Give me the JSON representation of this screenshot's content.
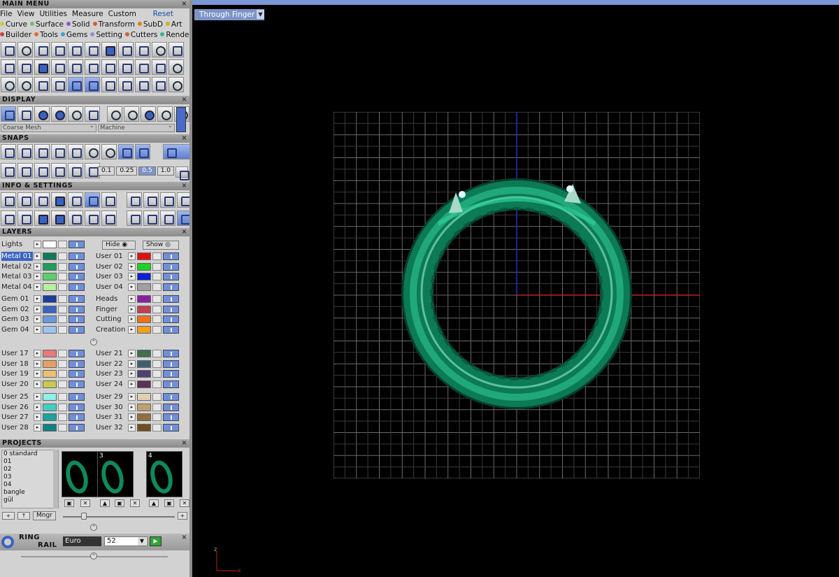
{
  "main_menu": {
    "title": "MAIN MENU",
    "menu": [
      "File",
      "View",
      "Utilities",
      "Measure",
      "Custom"
    ],
    "reset": "Reset",
    "tabs_row1": [
      {
        "label": "Curve",
        "color": "#c8c84a"
      },
      {
        "label": "Surface",
        "color": "#6cc06c"
      },
      {
        "label": "Solid",
        "color": "#8a5ad0"
      },
      {
        "label": "Transform",
        "color": "#d06030"
      },
      {
        "label": "SubD",
        "color": "#e08020"
      },
      {
        "label": "Art",
        "color": "#d0b020"
      }
    ],
    "tabs_row2": [
      {
        "label": "Builder",
        "color": "#d04040"
      },
      {
        "label": "Tools",
        "color": "#e07030"
      },
      {
        "label": "Gems",
        "color": "#40a0d0"
      },
      {
        "label": "Setting",
        "color": "#9090d0"
      },
      {
        "label": "Cutters",
        "color": "#d06040"
      },
      {
        "label": "Render",
        "color": "#40b090"
      }
    ]
  },
  "display": {
    "title": "DISPLAY",
    "mesh_combo": "Coarse Mesh",
    "material_combo": "Machine"
  },
  "snaps": {
    "title": "SNAPS",
    "values": [
      "0.1",
      "0.25",
      "0.5",
      "1.0"
    ]
  },
  "info": {
    "title": "INFO & SETTINGS"
  },
  "layers": {
    "title": "LAYERS",
    "lights": "Lights",
    "hide": "Hide",
    "show": "Show",
    "left_groups": [
      [
        {
          "name": "Metal 01",
          "color": "#0f7a5a"
        },
        {
          "name": "Metal 02",
          "color": "#1f9e5a"
        },
        {
          "name": "Metal 03",
          "color": "#5ccf6c"
        },
        {
          "name": "Metal 04",
          "color": "#b8f0a0"
        }
      ],
      [
        {
          "name": "Gem 01",
          "color": "#1e3c9a"
        },
        {
          "name": "Gem 02",
          "color": "#3a64c0"
        },
        {
          "name": "Gem 03",
          "color": "#6a98e0"
        },
        {
          "name": "Gem 04",
          "color": "#9cc4f0"
        }
      ],
      [
        {
          "name": "User 17",
          "color": "#e87a7a"
        },
        {
          "name": "User 18",
          "color": "#e8a060"
        },
        {
          "name": "User 19",
          "color": "#e8c070"
        },
        {
          "name": "User 20",
          "color": "#c8c850"
        }
      ],
      [
        {
          "name": "User 25",
          "color": "#8ef0e8"
        },
        {
          "name": "User 26",
          "color": "#40d0c0"
        },
        {
          "name": "User 27",
          "color": "#20a0a0"
        },
        {
          "name": "User 28",
          "color": "#108080"
        }
      ]
    ],
    "right_groups": [
      [
        {
          "name": "User 01",
          "color": "#e01010"
        },
        {
          "name": "User 02",
          "color": "#20d020"
        },
        {
          "name": "User 03",
          "color": "#1020d0"
        },
        {
          "name": "User 04",
          "color": "#a0a0a0"
        }
      ],
      [
        {
          "name": "Heads",
          "color": "#8a20a0"
        },
        {
          "name": "Finger",
          "color": "#c04050"
        },
        {
          "name": "Cutting",
          "color": "#f07020"
        },
        {
          "name": "Creation",
          "color": "#f0a020"
        }
      ],
      [
        {
          "name": "User 21",
          "color": "#407050"
        },
        {
          "name": "User 22",
          "color": "#406070"
        },
        {
          "name": "User 23",
          "color": "#504070"
        },
        {
          "name": "User 24",
          "color": "#603050"
        }
      ],
      [
        {
          "name": "User 29",
          "color": "#e0d0b0"
        },
        {
          "name": "User 30",
          "color": "#c0a070"
        },
        {
          "name": "User 31",
          "color": "#907040"
        },
        {
          "name": "User 32",
          "color": "#705020"
        }
      ]
    ]
  },
  "projects": {
    "title": "PROJECTS",
    "list": [
      "0 standard",
      "01",
      "02",
      "03",
      "04",
      "bangle",
      "gül"
    ],
    "thumb_numbers": [
      "",
      "3",
      "4"
    ],
    "mngr": "Mngr"
  },
  "ring_rail": {
    "title_top": "RING",
    "title_bottom": "RAIL",
    "standard": "Euro",
    "size": "52"
  },
  "viewport": {
    "view_select": "Through Finger",
    "axis_z": "z",
    "axis_x": "x"
  }
}
